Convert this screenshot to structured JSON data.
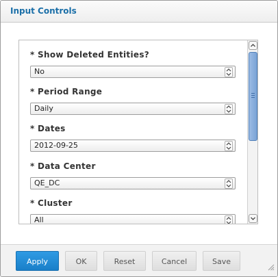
{
  "dialog": {
    "title": "Input Controls"
  },
  "controls": [
    {
      "label": "* Show Deleted Entities?",
      "value": "No"
    },
    {
      "label": "* Period Range",
      "value": "Daily"
    },
    {
      "label": "* Dates",
      "value": "2012-09-25"
    },
    {
      "label": "* Data Center",
      "value": "QE_DC"
    },
    {
      "label": "* Cluster",
      "value": "All"
    }
  ],
  "footer": {
    "apply_label": "Apply",
    "ok_label": "OK",
    "reset_label": "Reset",
    "cancel_label": "Cancel",
    "save_label": "Save"
  },
  "colors": {
    "title": "#1b6fa8",
    "primary_button": "#1a7fc9",
    "scroll_thumb": "#7aa3d6"
  },
  "icons": [
    "select-arrows-icon",
    "scroll-up-icon",
    "scroll-down-icon",
    "resize-grip-icon"
  ]
}
